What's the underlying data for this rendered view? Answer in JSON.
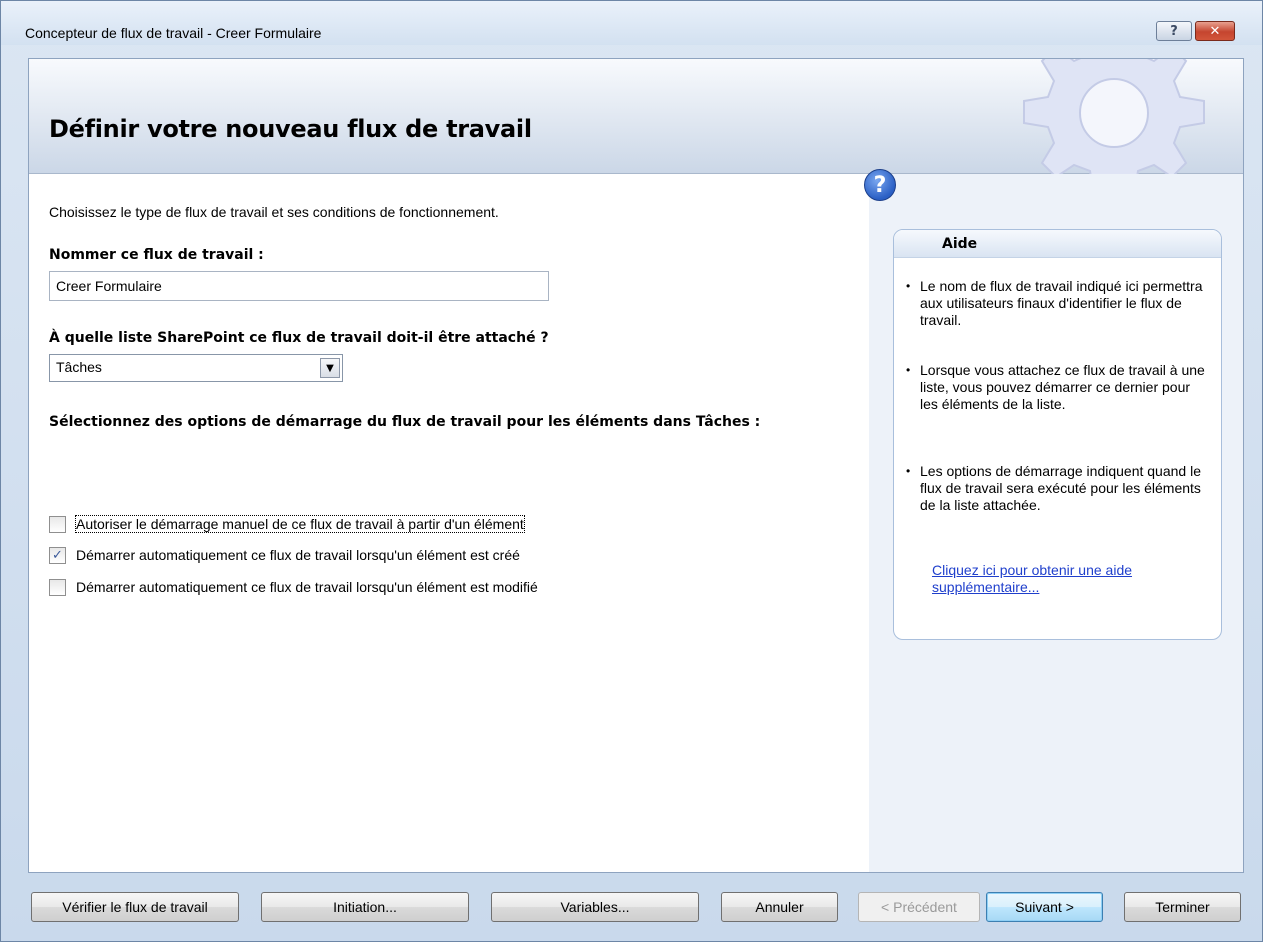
{
  "window": {
    "title": "Concepteur de flux de travail - Creer Formulaire",
    "help_button": "?",
    "close_button": "✕"
  },
  "header": {
    "title": "Définir votre nouveau flux de travail"
  },
  "main": {
    "intro": "Choisissez le type de flux de travail et ses conditions de fonctionnement.",
    "name_label": "Nommer ce flux de travail :",
    "name_value": "Creer Formulaire",
    "list_label": "À quelle liste SharePoint ce flux de travail doit-il être attaché ?",
    "list_selected": "Tâches",
    "start_label": "Sélectionnez des options de démarrage du flux de travail pour les éléments dans Tâches :",
    "options": [
      {
        "label": "Autoriser le démarrage manuel de ce flux de travail à partir d'un élément",
        "checked": false
      },
      {
        "label": "Démarrer automatiquement ce flux de travail lorsqu'un élément est créé",
        "checked": true
      },
      {
        "label": "Démarrer automatiquement ce flux de travail lorsqu'un élément est modifié",
        "checked": false
      }
    ]
  },
  "help": {
    "icon": "?",
    "title": "Aide",
    "items": [
      "Le nom de flux de travail indiqué ici permettra aux utilisateurs finaux d'identifier le flux de travail.",
      "Lorsque vous attachez ce flux de travail à une liste, vous pouvez démarrer ce dernier pour les éléments de la liste.",
      "Les options de démarrage indiquent quand le flux de travail sera exécuté pour les éléments de la liste attachée."
    ],
    "link": "Cliquez ici pour obtenir une aide supplémentaire..."
  },
  "footer": {
    "verify": "Vérifier le flux de travail",
    "initiation": "Initiation...",
    "variables": "Variables...",
    "cancel": "Annuler",
    "previous": "< Précédent",
    "next": "Suivant >",
    "finish": "Terminer"
  }
}
